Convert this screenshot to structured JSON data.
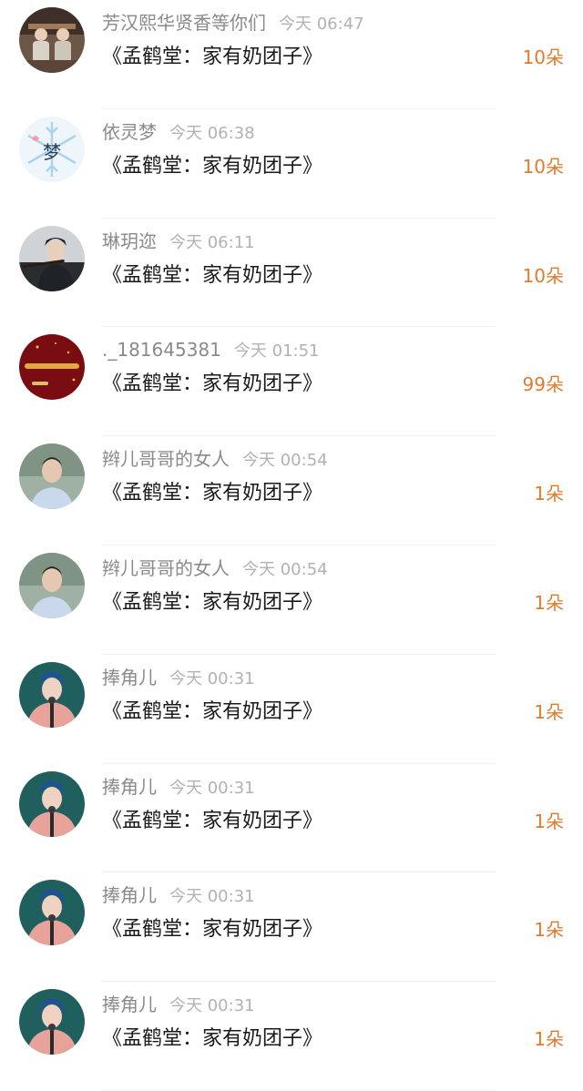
{
  "colors": {
    "username": "#8a8a8a",
    "time": "#b2b2b2",
    "title": "#1a1a1a",
    "amount": "#e07b2e"
  },
  "items": [
    {
      "username": "芳汉熙华贤香等你们",
      "time": "今天 06:47",
      "title": "《孟鹤堂：家有奶团子》",
      "amount": "10朵",
      "avatar_icon": "crosstalk-duo-avatar"
    },
    {
      "username": "依灵梦",
      "time": "今天 06:38",
      "title": "《孟鹤堂：家有奶团子》",
      "amount": "10朵",
      "avatar_icon": "snowflake-meng-avatar",
      "avatar_text": "梦"
    },
    {
      "username": "琳玥迩",
      "time": "今天 06:11",
      "title": "《孟鹤堂：家有奶团子》",
      "amount": "10朵",
      "avatar_icon": "flute-player-avatar"
    },
    {
      "username": "._181645381",
      "time": "今天 01:51",
      "title": "《孟鹤堂：家有奶团子》",
      "amount": "99朵",
      "avatar_icon": "red-banner-avatar"
    },
    {
      "username": "辫儿哥哥的女人",
      "time": "今天 00:54",
      "title": "《孟鹤堂：家有奶团子》",
      "amount": "1朵",
      "avatar_icon": "man-blue-shirt-avatar"
    },
    {
      "username": "辫儿哥哥的女人",
      "time": "今天 00:54",
      "title": "《孟鹤堂：家有奶团子》",
      "amount": "1朵",
      "avatar_icon": "man-blue-shirt-avatar"
    },
    {
      "username": "捧角儿",
      "time": "今天 00:31",
      "title": "《孟鹤堂：家有奶团子》",
      "amount": "1朵",
      "avatar_icon": "singer-microphone-avatar"
    },
    {
      "username": "捧角儿",
      "time": "今天 00:31",
      "title": "《孟鹤堂：家有奶团子》",
      "amount": "1朵",
      "avatar_icon": "singer-microphone-avatar"
    },
    {
      "username": "捧角儿",
      "time": "今天 00:31",
      "title": "《孟鹤堂：家有奶团子》",
      "amount": "1朵",
      "avatar_icon": "singer-microphone-avatar"
    },
    {
      "username": "捧角儿",
      "time": "今天 00:31",
      "title": "《孟鹤堂：家有奶团子》",
      "amount": "1朵",
      "avatar_icon": "singer-microphone-avatar"
    }
  ]
}
